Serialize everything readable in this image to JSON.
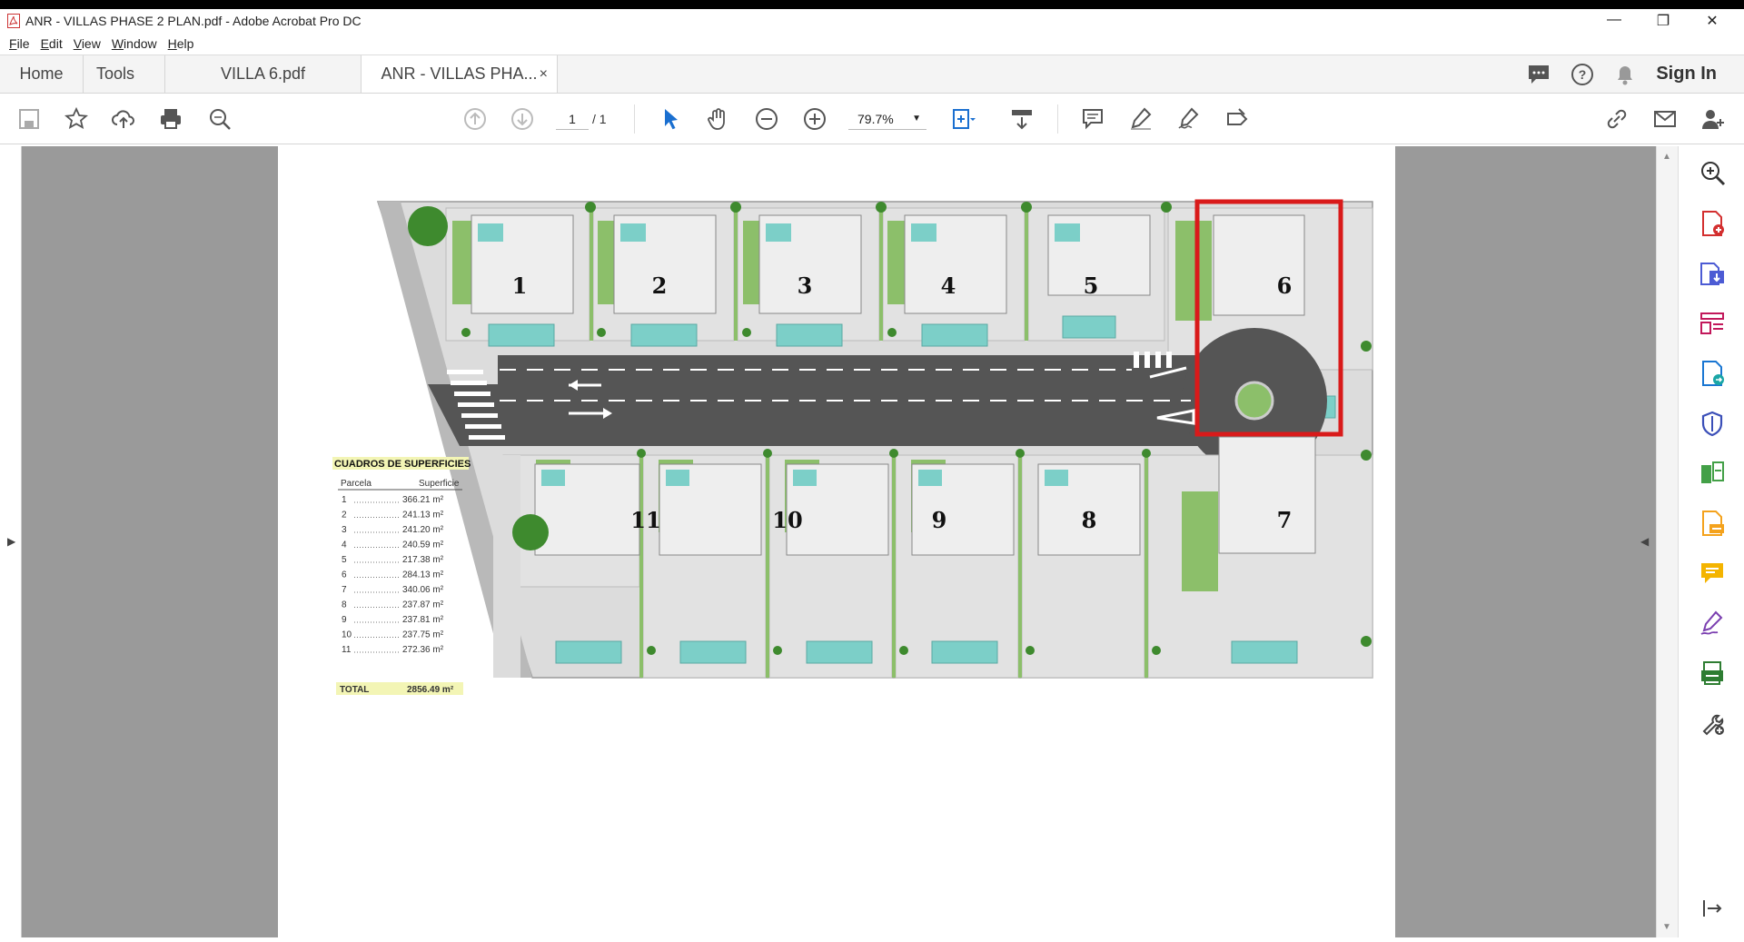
{
  "window": {
    "title": "ANR - VILLAS PHASE 2 PLAN.pdf - Adobe Acrobat Pro DC",
    "controls": {
      "minimize": "—",
      "restore": "❐",
      "close": "✕"
    }
  },
  "menu": [
    "File",
    "Edit",
    "View",
    "Window",
    "Help"
  ],
  "tabs": {
    "home": "Home",
    "tools": "Tools",
    "doc1": "VILLA 6.pdf",
    "doc2": "ANR - VILLAS PHA...",
    "doc2_close": "×",
    "sign_in": "Sign In"
  },
  "toolbar": {
    "page_current": "1",
    "page_total": "/ 1",
    "zoom": "79.7%"
  },
  "plan": {
    "table_title": "CUADROS DE SUPERFICIES",
    "col_parcela": "Parcela",
    "col_superficie": "Superficie",
    "rows": [
      {
        "parcela": "1",
        "superficie": "366.21 m²"
      },
      {
        "parcela": "2",
        "superficie": "241.13 m²"
      },
      {
        "parcela": "3",
        "superficie": "241.20 m²"
      },
      {
        "parcela": "4",
        "superficie": "240.59 m²"
      },
      {
        "parcela": "5",
        "superficie": "217.38 m²"
      },
      {
        "parcela": "6",
        "superficie": "284.13 m²"
      },
      {
        "parcela": "7",
        "superficie": "340.06 m²"
      },
      {
        "parcela": "8",
        "superficie": "237.87 m²"
      },
      {
        "parcela": "9",
        "superficie": "237.81 m²"
      },
      {
        "parcela": "10",
        "superficie": "237.75 m²"
      },
      {
        "parcela": "11",
        "superficie": "272.36 m²"
      }
    ],
    "total_label": "TOTAL",
    "total_value": "2856.49 m²",
    "plot_numbers": [
      "1",
      "2",
      "3",
      "4",
      "5",
      "6",
      "7",
      "8",
      "9",
      "10",
      "11"
    ],
    "highlight_color": "#d91a1a"
  },
  "icons": {
    "toolbar": [
      "save-icon",
      "bookmark-star-icon",
      "upload-cloud-icon",
      "print-icon",
      "find-icon",
      "page-up-icon",
      "page-down-icon",
      "select-cursor-icon",
      "hand-icon",
      "zoom-out-icon",
      "zoom-in-icon",
      "fit-page-icon",
      "scroll-mode-icon",
      "comment-icon",
      "highlight-pen-icon",
      "sign-icon",
      "stamp-icon",
      "share-link-icon",
      "email-icon",
      "add-user-icon"
    ],
    "right_panel": [
      "zoom-search-icon",
      "create-pdf-icon",
      "export-pdf-icon",
      "organize-pages-icon",
      "combine-files-icon",
      "protect-icon",
      "compare-icon",
      "fill-sign-icon",
      "comment-panel-icon",
      "signature-icon",
      "scan-icon",
      "more-tools-icon"
    ]
  }
}
